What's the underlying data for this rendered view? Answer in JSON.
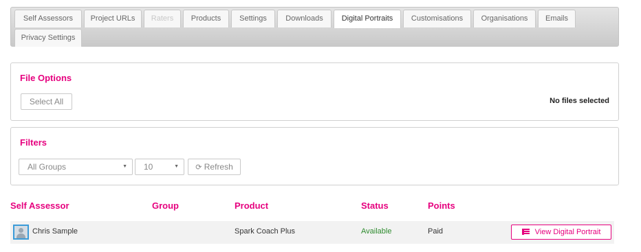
{
  "tabs": [
    {
      "label": "Self Assessors",
      "state": "normal"
    },
    {
      "label": "Project URLs",
      "state": "normal"
    },
    {
      "label": "Raters",
      "state": "disabled"
    },
    {
      "label": "Products",
      "state": "normal"
    },
    {
      "label": "Settings",
      "state": "normal"
    },
    {
      "label": "Downloads",
      "state": "normal"
    },
    {
      "label": "Digital Portraits",
      "state": "active"
    },
    {
      "label": "Customisations",
      "state": "normal"
    },
    {
      "label": "Organisations",
      "state": "normal"
    },
    {
      "label": "Emails",
      "state": "normal"
    },
    {
      "label": "Privacy Settings",
      "state": "normal"
    }
  ],
  "file_options": {
    "title": "File Options",
    "select_all_label": "Select All",
    "status_text": "No files selected"
  },
  "filters": {
    "title": "Filters",
    "group_select": "All Groups",
    "page_size_select": "10",
    "refresh_label": "Refresh",
    "refresh_icon": "refresh-icon"
  },
  "table": {
    "headers": [
      "Self Assessor",
      "Group",
      "Product",
      "Status",
      "Points"
    ],
    "rows": [
      {
        "name": "Chris Sample",
        "group": "",
        "product": "Spark Coach Plus",
        "status": "Available",
        "points": "Paid",
        "action_label": "View Digital Portrait",
        "action_icon": "list-icon"
      }
    ]
  },
  "colors": {
    "accent": "#e6007e",
    "status_available": "#2e8b2e",
    "avatar_border": "#3a9bd8"
  }
}
